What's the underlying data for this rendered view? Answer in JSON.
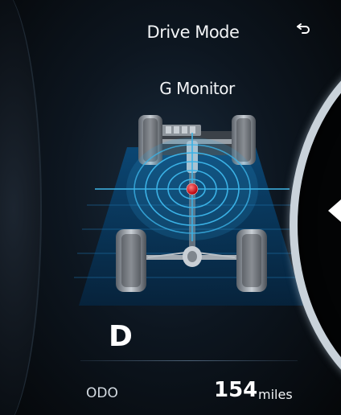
{
  "header": {
    "title": "Drive Mode",
    "back_icon": "return-arrow-icon"
  },
  "screen": {
    "subtitle": "G Monitor",
    "g_indicator_color": "#e0202a",
    "grid_color": "#3fb6e8"
  },
  "status": {
    "gear": "D",
    "odometer_label": "ODO",
    "odometer_value": "154",
    "odometer_unit": "miles"
  }
}
